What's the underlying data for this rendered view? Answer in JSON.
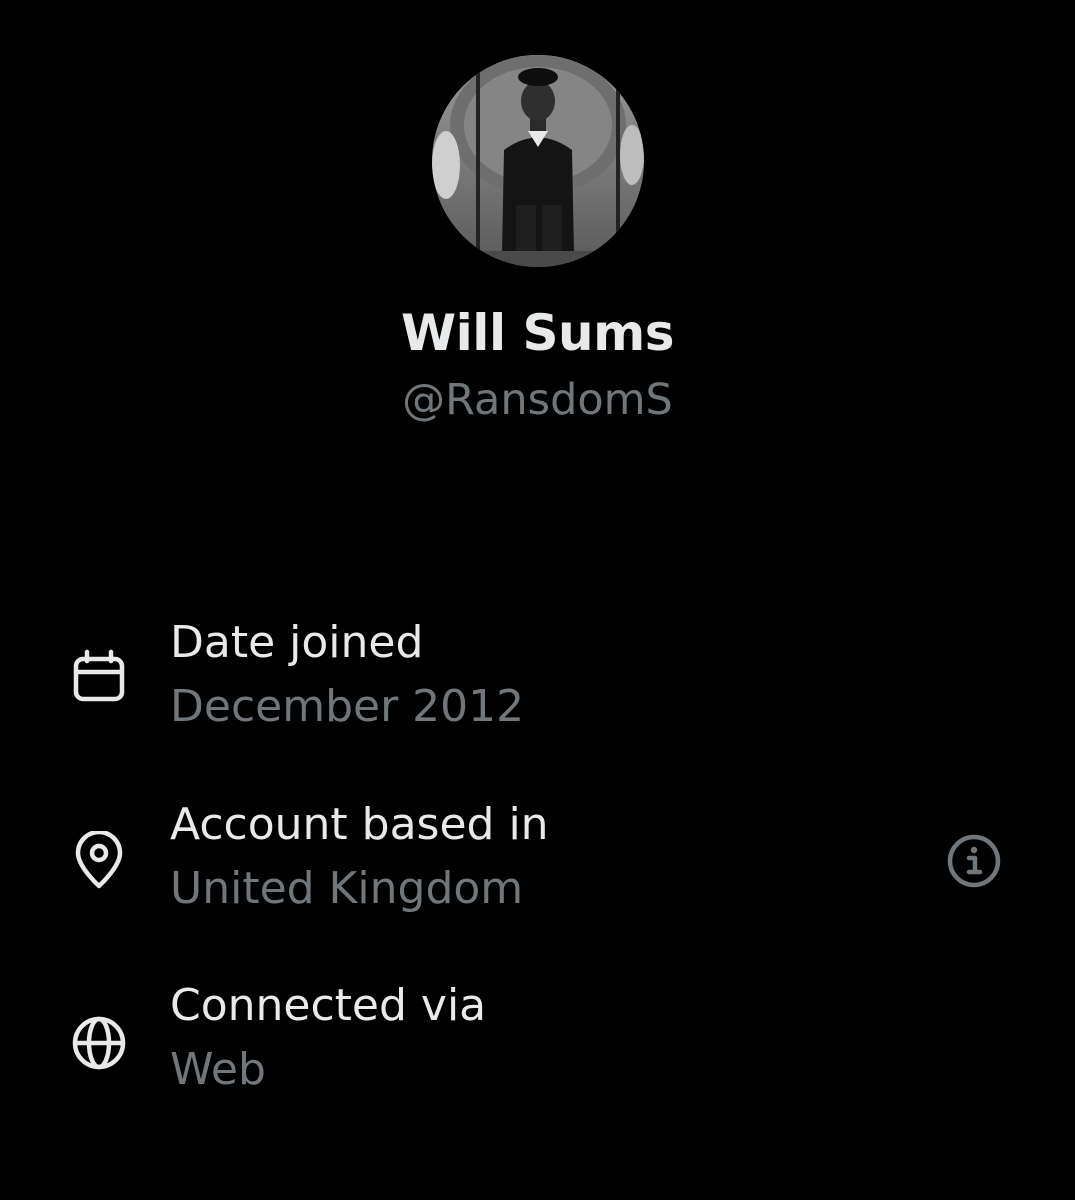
{
  "profile": {
    "display_name": "Will Sums",
    "handle": "@RansdomS"
  },
  "details": [
    {
      "icon": "calendar-icon",
      "label": "Date joined",
      "value": "December 2012"
    },
    {
      "icon": "location-pin-icon",
      "label": "Account based in",
      "value": "United Kingdom"
    },
    {
      "icon": "globe-icon",
      "label": "Connected via",
      "value": "Web"
    }
  ],
  "colors": {
    "background": "#000000",
    "primary_text": "#e7e9ea",
    "secondary_text": "#71767b"
  }
}
